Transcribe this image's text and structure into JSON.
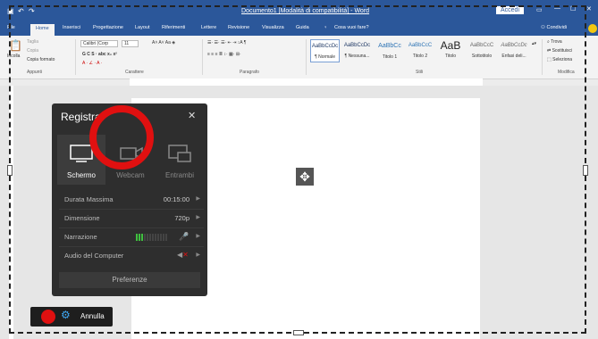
{
  "window": {
    "title": "Documento1 [Modalità di compatibilità] - Word",
    "account": "Accedi"
  },
  "ribbon": {
    "tabs": [
      {
        "label": "File"
      },
      {
        "label": "Home"
      },
      {
        "label": "Inserisci"
      },
      {
        "label": "Progettazione"
      },
      {
        "label": "Layout"
      },
      {
        "label": "Riferimenti"
      },
      {
        "label": "Lettere"
      },
      {
        "label": "Revisione"
      },
      {
        "label": "Visualizza"
      },
      {
        "label": "Guida"
      },
      {
        "label": "Cosa vuoi fare?"
      }
    ],
    "share": "Condividi",
    "clipboard": {
      "paste": "Incolla",
      "cut": "Taglia",
      "copy": "Copia",
      "format": "Copia formato",
      "label": "Appunti"
    },
    "font": {
      "name": "Calibri (Corp",
      "size": "11",
      "label": "Carattere"
    },
    "paragraph": {
      "label": "Paragrafo"
    },
    "styles": {
      "label": "Stili",
      "items": [
        {
          "preview": "AaBbCcDc",
          "name": "¶ Normale"
        },
        {
          "preview": "AaBbCcDc",
          "name": "¶ Nessuna..."
        },
        {
          "preview": "AaBbCc",
          "name": "Titolo 1"
        },
        {
          "preview": "AaBbCcC",
          "name": "Titolo 2"
        },
        {
          "preview": "AaB",
          "name": "Titolo"
        },
        {
          "preview": "AaBbCcC",
          "name": "Sottotitolo"
        },
        {
          "preview": "AaBbCcDc",
          "name": "Enfasi deli..."
        }
      ]
    },
    "editing": {
      "find": "Trova",
      "replace": "Sostituisci",
      "select": "Seleziona",
      "label": "Modifica"
    }
  },
  "recorder": {
    "title": "Registra",
    "modes": [
      {
        "label": "Schermo"
      },
      {
        "label": "Webcam"
      },
      {
        "label": "Entrambi"
      }
    ],
    "settings": [
      {
        "key": "Durata Massima",
        "value": "00:15:00"
      },
      {
        "key": "Dimensione",
        "value": "720p"
      },
      {
        "key": "Narrazione",
        "value": ""
      },
      {
        "key": "Audio del Computer",
        "value": ""
      }
    ],
    "preferences": "Preferenze",
    "cancel": "Annulla"
  }
}
